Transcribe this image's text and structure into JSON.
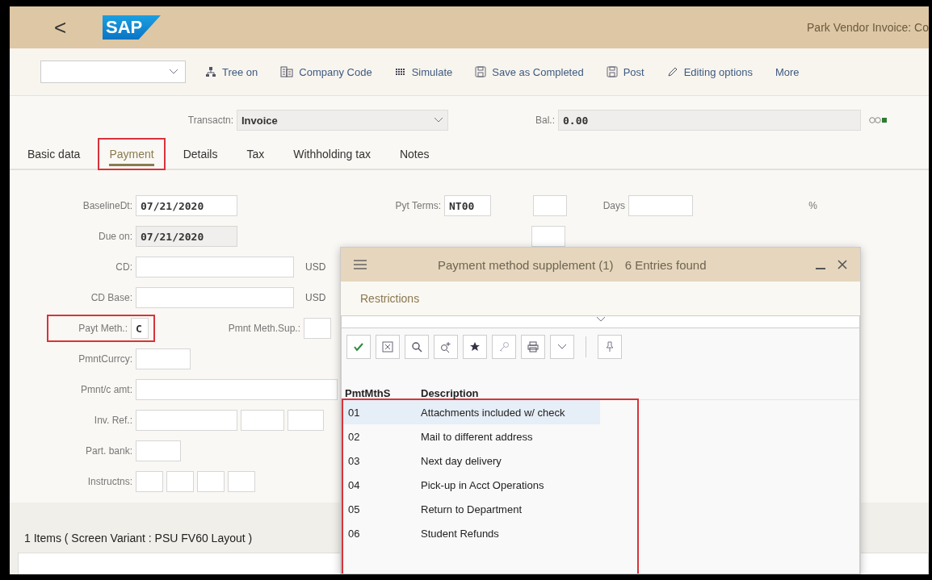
{
  "header": {
    "back": "<",
    "logo": "SAP",
    "title": "Park Vendor Invoice: Co"
  },
  "toolbar": {
    "actions": [
      {
        "kind": "tree",
        "label": "Tree on"
      },
      {
        "kind": "company",
        "label": "Company Code"
      },
      {
        "kind": "simulate",
        "label": "Simulate"
      },
      {
        "kind": "save",
        "label": "Save as Completed"
      },
      {
        "kind": "save",
        "label": "Post"
      },
      {
        "kind": "pencil",
        "label": "Editing options"
      },
      {
        "kind": "text",
        "label": "More"
      }
    ]
  },
  "transaction": {
    "label": "Transactn:",
    "value": "Invoice"
  },
  "balance": {
    "label": "Bal.:",
    "value": "0.00"
  },
  "tabs": [
    {
      "label": "Basic data",
      "selected": false,
      "highlighted": false
    },
    {
      "label": "Payment",
      "selected": true,
      "highlighted": true
    },
    {
      "label": "Details",
      "selected": false,
      "highlighted": false
    },
    {
      "label": "Tax",
      "selected": false,
      "highlighted": false
    },
    {
      "label": "Withholding tax",
      "selected": false,
      "highlighted": false
    },
    {
      "label": "Notes",
      "selected": false,
      "highlighted": false
    }
  ],
  "form": [
    {
      "label": "BaselineDt:",
      "fields": [
        {
          "value": "07/21/2020",
          "readonly": false
        }
      ]
    },
    {
      "label": "Due on:",
      "fields": [
        {
          "value": "07/21/2020",
          "readonly": true
        }
      ]
    },
    {
      "label": "CD:",
      "fields": [
        {
          "readonly": false
        }
      ],
      "unit": "USD"
    },
    {
      "label": "CD Base:",
      "fields": [
        {
          "readonly": false
        }
      ],
      "unit": "USD"
    },
    {
      "label": "Payt Meth.:",
      "highlighted": true,
      "fields": [
        {
          "value": "C",
          "readonly": false
        }
      ],
      "extra_label": "Pmnt Meth.Sup.:",
      "extra_fields": [
        {
          "readonly": false
        }
      ]
    },
    {
      "label": "PmntCurrcy:",
      "fields": [
        {
          "readonly": false
        }
      ]
    },
    {
      "label": "Pmnt/c amt:",
      "fields": [
        {
          "readonly": false
        }
      ]
    },
    {
      "label": "Inv. Ref.:",
      "fields": [
        {
          "readonly": false
        },
        {
          "readonly": false
        },
        {
          "readonly": false
        }
      ]
    },
    {
      "label": "Part. bank:",
      "fields": [
        {
          "readonly": false
        }
      ]
    },
    {
      "label": "Instructns:",
      "fields": [
        {
          "readonly": false
        },
        {
          "readonly": false
        },
        {
          "readonly": false
        },
        {
          "readonly": false
        }
      ]
    }
  ],
  "payment_terms": {
    "label": "Pyt Terms:",
    "value": "NT00",
    "days_label": "Days",
    "percent": "%"
  },
  "items_title": "1 Items ( Screen Variant : PSU FV60 Layout )",
  "dialog": {
    "title": "Payment method supplement (1)",
    "count": "6 Entries found",
    "restrictions": "Restrictions",
    "tools": [
      {
        "kind": "check"
      },
      {
        "kind": "cancel"
      },
      {
        "kind": "search"
      },
      {
        "kind": "search-plus"
      },
      {
        "kind": "star"
      },
      {
        "kind": "key"
      },
      {
        "kind": "print"
      },
      {
        "kind": "caret"
      },
      {
        "kind": "pin"
      }
    ],
    "columns": [
      "PmtMthS",
      "Description"
    ],
    "highlighted": true,
    "rows": [
      {
        "code": "01",
        "description": "Attachments included w/ check",
        "selected": true
      },
      {
        "code": "02",
        "description": "Mail to different address",
        "selected": false
      },
      {
        "code": "03",
        "description": "Next day delivery",
        "selected": false
      },
      {
        "code": "04",
        "description": "Pick-up in Acct Operations",
        "selected": false
      },
      {
        "code": "05",
        "description": "Return to Department",
        "selected": false
      },
      {
        "code": "06",
        "description": "Student Refunds",
        "selected": false
      }
    ]
  }
}
